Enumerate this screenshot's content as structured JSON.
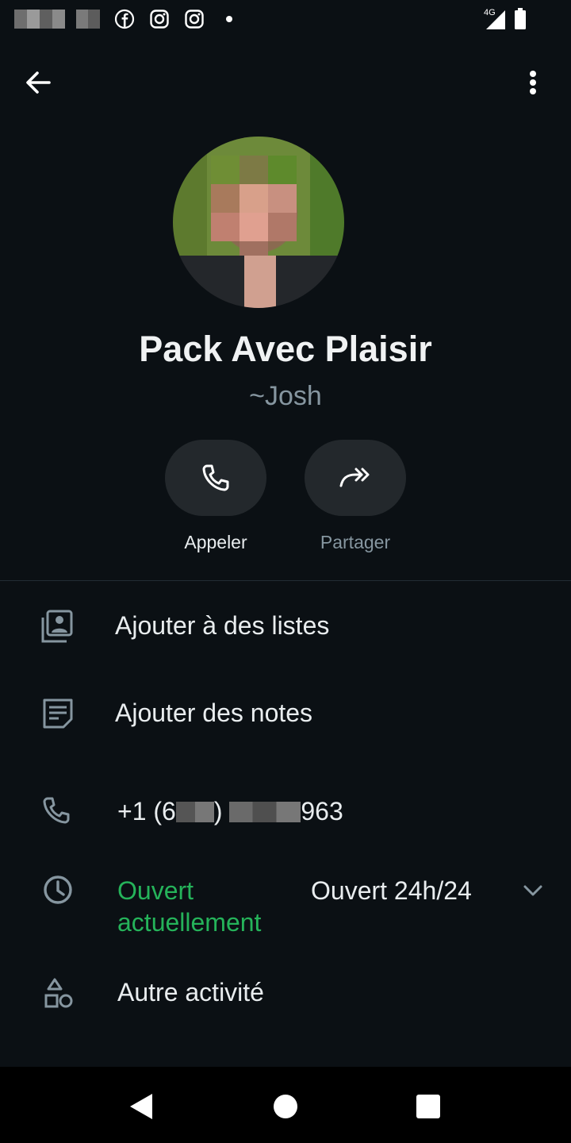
{
  "statusbar": {
    "network": "4G",
    "icons": [
      "facebook-icon",
      "instagram-icon",
      "instagram-icon",
      "notification-dot",
      "signal-icon",
      "battery-icon"
    ]
  },
  "topbar": {
    "icons": [
      "back-arrow-icon",
      "more-vert-icon"
    ]
  },
  "contact": {
    "name": "Pack Avec Plaisir",
    "subname": "~Josh"
  },
  "actions": [
    {
      "label": "Appeler",
      "icon": "phone-icon",
      "enabled": true
    },
    {
      "label": "Partager",
      "icon": "share-forward-icon",
      "enabled": false
    }
  ],
  "rows": {
    "lists": {
      "label": "Ajouter à des listes",
      "icon": "list-contacts-icon"
    },
    "notes": {
      "label": "Ajouter des notes",
      "icon": "note-icon"
    },
    "phone": {
      "prefix": "+1 (6",
      "suffix": "963",
      "icon": "phone-icon"
    },
    "hours": {
      "status": "Ouvert actuellement",
      "detail": "Ouvert 24h/24",
      "icon": "clock-icon"
    },
    "activity": {
      "label": "Autre activité",
      "icon": "shapes-icon"
    }
  },
  "colors": {
    "background": "#0b1014",
    "open_green": "#25b35a",
    "muted": "#8696a0",
    "button_bg": "#23282c"
  }
}
